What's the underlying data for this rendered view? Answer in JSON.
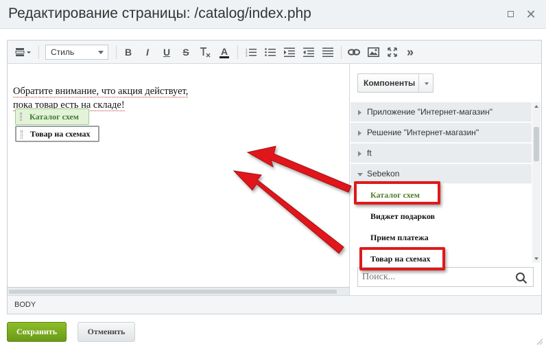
{
  "window": {
    "title": "Редактирование страницы: /catalog/index.php"
  },
  "toolbar": {
    "style_select": "Стиль",
    "bold": "B",
    "italic": "I",
    "underline": "U",
    "strike": "S",
    "clear_format": "T",
    "font_color": "A",
    "more": "»"
  },
  "content": {
    "line1": "Обратите внимание, что акция действует,",
    "line2": "пока товар есть на складе!",
    "chips": [
      "Каталог схем",
      "Товар на схемах"
    ]
  },
  "statusbar": {
    "path": "BODY"
  },
  "sidebar": {
    "components_button": "Компоненты",
    "groups": [
      "Приложение \"Интернет-магазин\"",
      "Решение \"Интернет-магазин\"",
      "ft",
      "Sebekon"
    ],
    "items": [
      "Каталог схем",
      "Виджет подарков",
      "Прием платежа",
      "Товар на схемах"
    ],
    "search_placeholder": "Поиск..."
  },
  "footer": {
    "save": "Сохранить",
    "cancel": "Отменить"
  },
  "colors": {
    "accent_green": "#7aaa20",
    "highlight_red": "#e0191a",
    "chip_green_text": "#3f7b2a"
  }
}
